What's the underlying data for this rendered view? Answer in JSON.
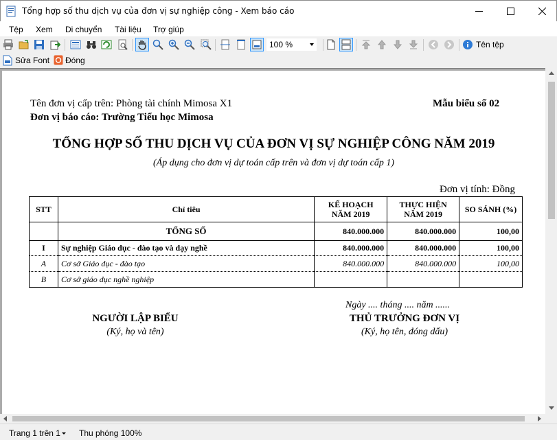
{
  "window": {
    "title": "Tổng hợp số thu dịch vụ của đơn vị sự nghiệp công - Xem báo cáo"
  },
  "menu": [
    "Tệp",
    "Xem",
    "Di chuyển",
    "Tài liệu",
    "Trợ giúp"
  ],
  "toolbar": {
    "zoom_value": "100 %",
    "file_name_label": "Tên tệp",
    "edit_font_label": "Sửa Font",
    "close_label": "Đóng"
  },
  "report": {
    "parent_unit": "Tên đơn vị cấp trên: Phòng tài chính Mimosa X1",
    "reporting_unit": "Đơn vị báo cáo: Trường Tiểu học Mimosa",
    "form_number": "Mẫu biểu số 02",
    "title": "TỔNG HỢP SỐ THU DỊCH VỤ CỦA ĐƠN VỊ SỰ NGHIỆP CÔNG NĂM 2019",
    "subtitle": "(Áp dụng cho đơn vị dự toán cấp trên và đơn vị dự toán cấp 1)",
    "unit_of_measure": "Đơn vị tính: Đồng",
    "columns": {
      "stt": "STT",
      "indicator": "Chỉ tiêu",
      "plan_line1": "KẾ HOẠCH",
      "plan_line2": "NĂM 2019",
      "actual_line1": "THỰC HIỆN",
      "actual_line2": "NĂM 2019",
      "compare": "SO SÁNH (%)"
    },
    "rows": [
      {
        "stt": "",
        "indicator": "TỔNG SỐ",
        "plan": "840.000.000",
        "actual": "840.000.000",
        "compare": "100,00"
      },
      {
        "stt": "I",
        "indicator": "Sự nghiệp Giáo dục - đào tạo và dạy nghề",
        "plan": "840.000.000",
        "actual": "840.000.000",
        "compare": "100,00"
      },
      {
        "stt": "A",
        "indicator": "Cơ sở Giáo dục - đào tạo",
        "plan": "840.000.000",
        "actual": "840.000.000",
        "compare": "100,00"
      },
      {
        "stt": "B",
        "indicator": "Cơ sở giáo dục nghề nghiệp",
        "plan": "",
        "actual": "",
        "compare": ""
      }
    ],
    "date_line": "Ngày .... tháng .... năm ......",
    "preparer_title": "NGƯỜI LẬP BIỂU",
    "preparer_note": "(Ký, họ và tên)",
    "head_title": "THỦ TRƯỞNG ĐƠN VỊ",
    "head_note": "(Ký, họ tên, đóng dấu)"
  },
  "status": {
    "page": "Trang 1 trên 1",
    "zoom": "Thu phóng 100%"
  }
}
